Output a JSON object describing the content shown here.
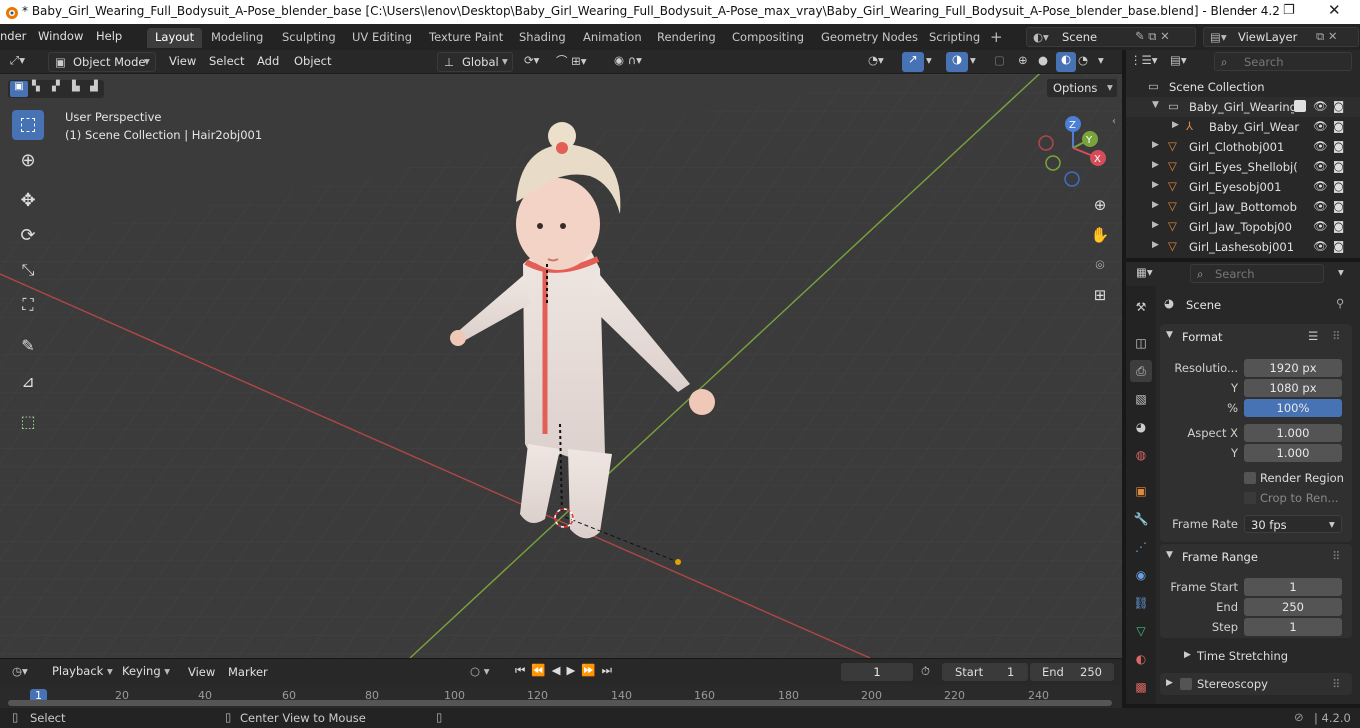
{
  "window": {
    "title": "* Baby_Girl_Wearing_Full_Bodysuit_A-Pose_blender_base [C:\\Users\\lenov\\Desktop\\Baby_Girl_Wearing_Full_Bodysuit_A-Pose_max_vray\\Baby_Girl_Wearing_Full_Bodysuit_A-Pose_blender_base.blend] - Blender 4.2"
  },
  "menus": [
    "nder",
    "Window",
    "Help"
  ],
  "workspaces": [
    "Layout",
    "Modeling",
    "Sculpting",
    "UV Editing",
    "Texture Paint",
    "Shading",
    "Animation",
    "Rendering",
    "Compositing",
    "Geometry Nodes",
    "Scripting"
  ],
  "scene_field": "Scene",
  "viewlayer_field": "ViewLayer",
  "viewport_header": {
    "mode": "Object Mode",
    "menus": [
      "View",
      "Select",
      "Add",
      "Object"
    ],
    "orientation": "Global",
    "options_label": "Options"
  },
  "viewport": {
    "perspective": "User Perspective",
    "collection_info": "(1) Scene Collection | Hair2obj001",
    "axes": {
      "x": "X",
      "y": "Y",
      "z": "Z"
    }
  },
  "outliner": {
    "search_placeholder": "Search",
    "root": "Scene Collection",
    "items": [
      {
        "name": "Baby_Girl_Wearing_",
        "icon": "collection-icon"
      },
      {
        "name": "Baby_Girl_Wear",
        "icon": "armature-icon"
      },
      {
        "name": "Girl_Clothobj001",
        "icon": "mesh-icon"
      },
      {
        "name": "Girl_Eyes_Shellobj(",
        "icon": "mesh-icon"
      },
      {
        "name": "Girl_Eyesobj001",
        "icon": "mesh-icon"
      },
      {
        "name": "Girl_Jaw_Bottomob",
        "icon": "mesh-icon"
      },
      {
        "name": "Girl_Jaw_Topobj00",
        "icon": "mesh-icon"
      },
      {
        "name": "Girl_Lashesobj001",
        "icon": "mesh-icon"
      }
    ]
  },
  "properties": {
    "search_placeholder": "Search",
    "context": "Scene",
    "format": {
      "title": "Format",
      "resolution_label": "Resolutio...",
      "res_x": "1920 px",
      "y_label": "Y",
      "res_y": "1080 px",
      "pct_label": "%",
      "pct": "100%",
      "aspect_x_label": "Aspect X",
      "aspect_x": "1.000",
      "aspect_y_label": "Y",
      "aspect_y": "1.000",
      "render_region": "Render Region",
      "crop": "Crop to Ren...",
      "frame_rate_label": "Frame Rate",
      "frame_rate": "30 fps"
    },
    "frame_range": {
      "title": "Frame Range",
      "start_label": "Frame Start",
      "start": "1",
      "end_label": "End",
      "end": "250",
      "step_label": "Step",
      "step": "1"
    },
    "time_stretching": "Time Stretching",
    "stereoscopy": "Stereoscopy"
  },
  "timeline": {
    "menus": [
      "Playback",
      "Keying",
      "View",
      "Marker"
    ],
    "current_frame": "1",
    "start_label": "Start",
    "start": "1",
    "end_label": "End",
    "end": "250",
    "ticks": [
      "1",
      "20",
      "40",
      "60",
      "80",
      "100",
      "120",
      "140",
      "160",
      "180",
      "200",
      "220",
      "240"
    ]
  },
  "statusbar": {
    "select": "Select",
    "center": "Center View to Mouse",
    "version": "4.2.0"
  },
  "colors": {
    "accent": "#4772b3",
    "viewport_bg": "#3d3d3d",
    "panel_bg": "#282828"
  }
}
